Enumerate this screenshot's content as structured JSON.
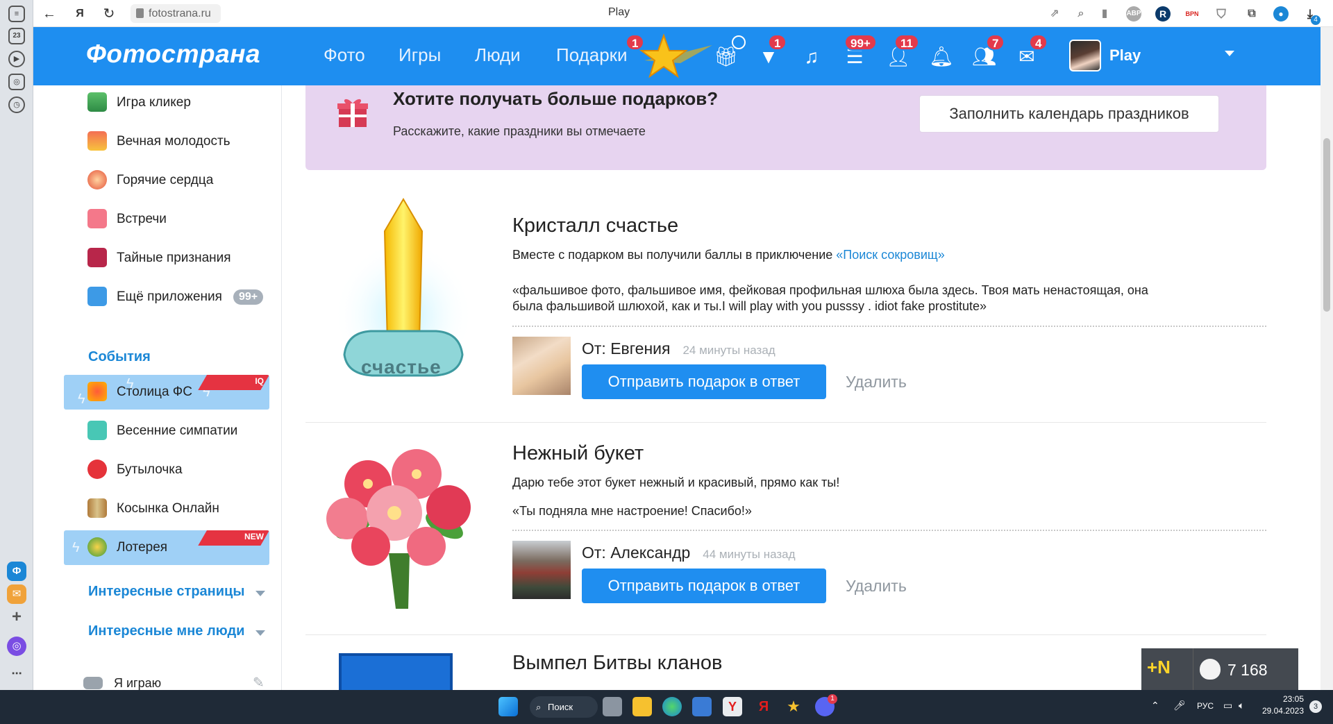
{
  "browser": {
    "url": "fotostrana.ru",
    "tab_title": "Play",
    "sidebar_badge": "23",
    "ext_labels": [
      "ABP",
      "R",
      "BPN"
    ],
    "ext_badge": "4"
  },
  "header": {
    "logo": "Фотострана",
    "nav": [
      "Фото",
      "Игры",
      "Люди",
      "Подарки"
    ],
    "badges": {
      "gifts_nav": "1",
      "vip": "1",
      "feed": "99+",
      "requests": "11",
      "friends": "7",
      "messages": "4"
    },
    "user_name": "Play"
  },
  "sidebar": {
    "apps": [
      {
        "label": "Игра кликер"
      },
      {
        "label": "Вечная молодость"
      },
      {
        "label": "Горячие сердца"
      },
      {
        "label": "Встречи"
      },
      {
        "label": "Тайные признания"
      },
      {
        "label": "Ещё приложения",
        "badge": "99+"
      }
    ],
    "events_title": "События",
    "events": [
      {
        "label": "Столица ФС",
        "tag": "IQ"
      },
      {
        "label": "Весенние симпатии"
      },
      {
        "label": "Бутылочка"
      },
      {
        "label": "Косынка Онлайн"
      },
      {
        "label": "Лотерея",
        "tag": "NEW"
      }
    ],
    "interesting_pages": "Интересные страницы",
    "interesting_people": "Интересные мне люди",
    "playing": "Я играю"
  },
  "promo": {
    "title": "Хотите получать больше подарков?",
    "subtitle": "Расскажите, какие праздники вы отмечаете",
    "button": "Заполнить календарь праздников"
  },
  "gifts": [
    {
      "name": "Кристалл счастье",
      "image_text": "счастье",
      "desc": "Вместе с подарком вы получили баллы в приключение ",
      "link": "«Поиск сокровищ»",
      "message": "«фальшивое фото, фальшивое имя, фейковая профильная шлюха была здесь. Твоя мать ненастоящая, она была фальшивой шлюхой, как и ты.I will play with you pusssy . idiot fake prostitute»",
      "from": "От: Евгения",
      "time": "24 минуты назад",
      "reply": "Отправить подарок в ответ",
      "delete": "Удалить"
    },
    {
      "name": "Нежный букет",
      "desc": "Дарю тебе этот букет нежный и красивый, прямо как ты!",
      "message": "«Ты подняла мне настроение! Спасибо!»",
      "from": "От: Александр",
      "time": "44 минуты назад",
      "reply": "Отправить подарок в ответ",
      "delete": "Удалить"
    },
    {
      "name": "Вымпел Битвы кланов"
    }
  ],
  "counter": {
    "new_label": "+N",
    "coins": "7 168"
  },
  "taskbar": {
    "search": "Поиск",
    "lang": "РУС",
    "time": "23:05",
    "date": "29.04.2023",
    "discord_badge": "1",
    "notify_badge": "3"
  },
  "colors": {
    "brand": "#1e8ef0",
    "badge": "#e33a4b",
    "promo_bg": "#e7d4f0",
    "link": "#1b87d6",
    "highlight": "#9fd0f6"
  }
}
